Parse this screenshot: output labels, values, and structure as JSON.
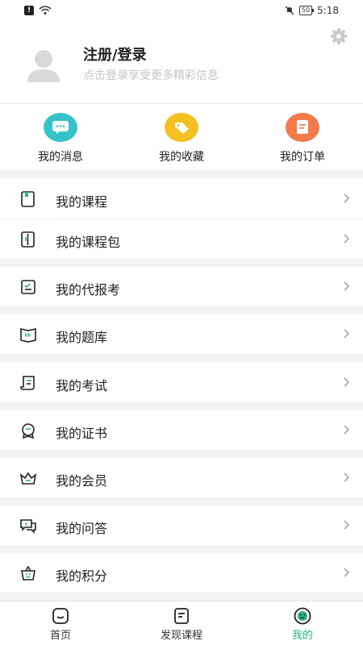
{
  "status_bar": {
    "time": "5:18",
    "battery": "50"
  },
  "profile": {
    "title": "注册/登录",
    "subtitle": "点击登录享受更多精彩信息"
  },
  "quick_actions": [
    {
      "label": "我的消息",
      "icon": "message-icon",
      "color": "#36c2c9"
    },
    {
      "label": "我的收藏",
      "icon": "favorite-icon",
      "color": "#f4c022"
    },
    {
      "label": "我的订单",
      "icon": "order-icon",
      "color": "#f37a4b"
    }
  ],
  "menu": [
    {
      "label": "我的课程",
      "icon": "course-icon"
    },
    {
      "label": "我的课程包",
      "icon": "course-pack-icon"
    },
    {
      "label": "我的代报考",
      "icon": "proxy-exam-icon"
    },
    {
      "label": "我的题库",
      "icon": "question-bank-icon"
    },
    {
      "label": "我的考试",
      "icon": "exam-icon"
    },
    {
      "label": "我的证书",
      "icon": "certificate-icon"
    },
    {
      "label": "我的会员",
      "icon": "membership-icon"
    },
    {
      "label": "我的问答",
      "icon": "qa-icon"
    },
    {
      "label": "我的积分",
      "icon": "points-icon"
    }
  ],
  "tabs": [
    {
      "label": "首页",
      "icon": "home-icon"
    },
    {
      "label": "发现课程",
      "icon": "discover-icon"
    },
    {
      "label": "我的",
      "icon": "mine-icon",
      "active": true
    }
  ],
  "colors": {
    "accent": "#2fb380"
  }
}
